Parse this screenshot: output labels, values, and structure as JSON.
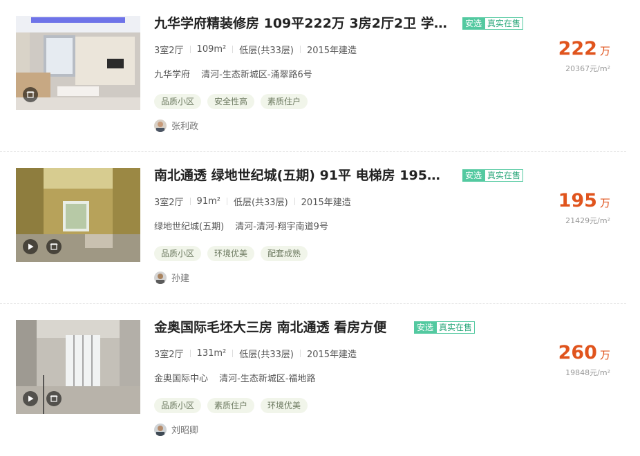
{
  "listings": [
    {
      "title": "九华学府精装修房 109平222万 3房2厅2卫 学…",
      "tag_a": "安选",
      "tag_b": "真实在售",
      "layout": "3室2厅",
      "area": "109m²",
      "floor": "低层(共33层)",
      "year": "2015年建造",
      "community": "九华学府",
      "address": "清河-生态新城区-涌翠路6号",
      "features": [
        "品质小区",
        "安全性高",
        "素质住户"
      ],
      "agent": "张利政",
      "price": "222",
      "price_unit": "万",
      "unit_price": "20367元/m²",
      "has_video": false
    },
    {
      "title": "南北通透 绿地世纪城(五期) 91平 电梯房 195…",
      "tag_a": "安选",
      "tag_b": "真实在售",
      "layout": "3室2厅",
      "area": "91m²",
      "floor": "低层(共33层)",
      "year": "2015年建造",
      "community": "绿地世纪城(五期)",
      "address": "清河-清河-翔宇南道9号",
      "features": [
        "品质小区",
        "环境优美",
        "配套成熟"
      ],
      "agent": "孙建",
      "price": "195",
      "price_unit": "万",
      "unit_price": "21429元/m²",
      "has_video": true
    },
    {
      "title": "金奥国际毛坯大三房 南北通透 看房方便",
      "tag_a": "安选",
      "tag_b": "真实在售",
      "layout": "3室2厅",
      "area": "131m²",
      "floor": "低层(共33层)",
      "year": "2015年建造",
      "community": "金奥国际中心",
      "address": "清河-生态新城区-福地路",
      "features": [
        "品质小区",
        "素质住户",
        "环境优美"
      ],
      "agent": "刘昭卿",
      "price": "260",
      "price_unit": "万",
      "unit_price": "19848元/m²",
      "has_video": true
    }
  ],
  "colors": {
    "price": "#e0541d",
    "tag": "#53c9a0",
    "feature_bg": "#f1f5ea"
  },
  "icons": {
    "video": "play-icon",
    "gallery": "gallery-icon"
  }
}
